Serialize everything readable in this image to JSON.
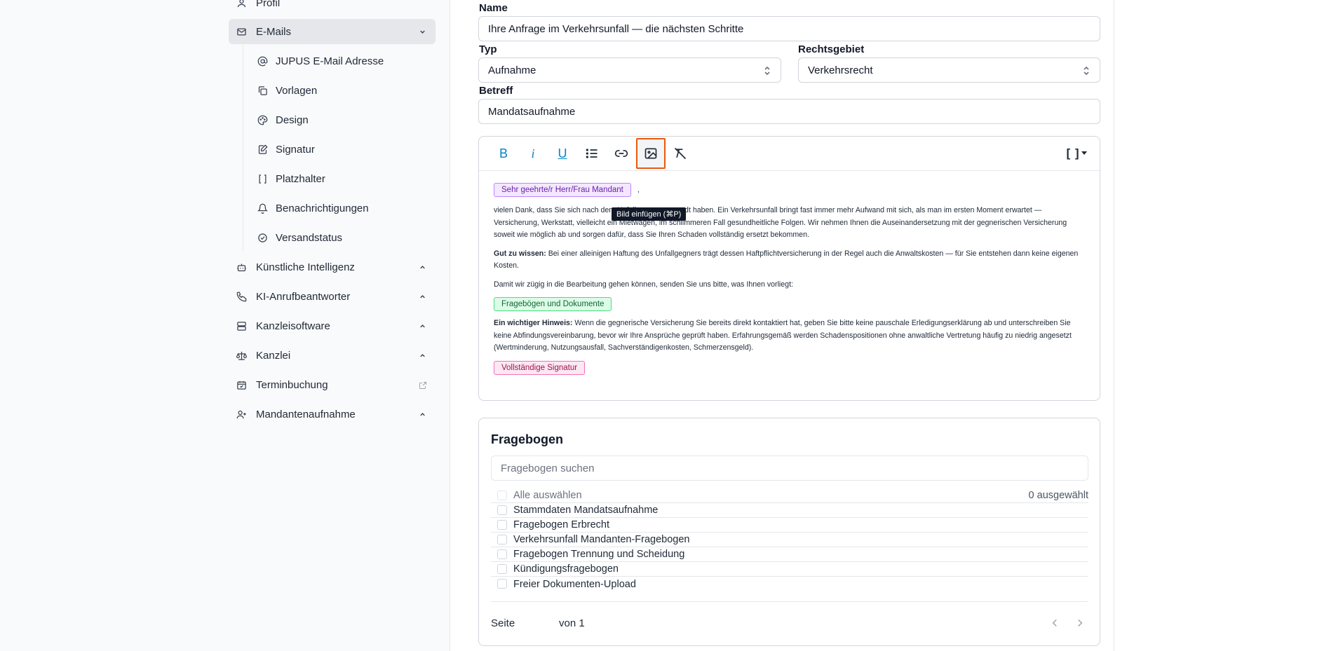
{
  "sidebar": {
    "items": [
      {
        "label": "Profil",
        "icon": "user-icon"
      },
      {
        "label": "E-Mails",
        "icon": "mail-icon",
        "expanded": true
      },
      {
        "label": "Künstliche Intelligenz",
        "icon": "bot-icon"
      },
      {
        "label": "KI-Anrufbeantworter",
        "icon": "phone-icon"
      },
      {
        "label": "Kanzleisoftware",
        "icon": "server-icon"
      },
      {
        "label": "Kanzlei",
        "icon": "scale-icon"
      },
      {
        "label": "Terminbuchung",
        "icon": "calendar-icon"
      },
      {
        "label": "Mandantenaufnahme",
        "icon": "user-plus-icon"
      }
    ],
    "email_subitems": [
      {
        "label": "JUPUS E-Mail Adresse",
        "icon": "at-icon"
      },
      {
        "label": "Vorlagen",
        "icon": "copy-icon"
      },
      {
        "label": "Design",
        "icon": "palette-icon"
      },
      {
        "label": "Signatur",
        "icon": "edit-icon"
      },
      {
        "label": "Platzhalter",
        "icon": "brackets-icon"
      },
      {
        "label": "Benachrichtigungen",
        "icon": "bell-icon"
      },
      {
        "label": "Versandstatus",
        "icon": "check-circle-icon"
      }
    ]
  },
  "form": {
    "name_label": "Name",
    "name_value": "Ihre Anfrage im Verkehrsunfall — die nächsten Schritte",
    "type_label": "Typ",
    "type_value": "Aufnahme",
    "area_label": "Rechtsgebiet",
    "area_value": "Verkehrsrecht",
    "subject_label": "Betreff",
    "subject_value": "Mandatsaufnahme"
  },
  "editor": {
    "tooltip": "Bild einfügen (⌘P)",
    "toolbar": {
      "bold": "B",
      "italic": "i",
      "underline": "U",
      "placeholder_menu": "[ ]"
    },
    "chip_greeting": "Sehr geehrte/r Herr/Frau Mandant",
    "greeting_suffix": ",",
    "p1": "vielen Dank, dass Sie sich nach dem Unfall an uns gewandt haben. Ein Verkehrsunfall bringt fast immer mehr Aufwand mit sich, als man im ersten Moment erwartet — Versicherung, Werkstatt, vielleicht ein Mietwagen, im schlimmeren Fall gesundheitliche Folgen. Wir nehmen Ihnen die Auseinandersetzung mit der gegnerischen Versicherung soweit wie möglich ab und sorgen dafür, dass Sie Ihren Schaden vollständig ersetzt bekommen.",
    "p2_bold": "Gut zu wissen:",
    "p2": " Bei einer alleinigen Haftung des Unfallgegners trägt dessen Haftpflichtversicherung in der Regel auch die Anwaltskosten — für Sie entstehen dann keine eigenen Kosten.",
    "p3": "Damit wir zügig in die Bearbeitung gehen können, senden Sie uns bitte, was Ihnen vorliegt:",
    "chip_docs": "Fragebögen und Dokumente",
    "p4_bold": "Ein wichtiger Hinweis:",
    "p4": " Wenn die gegnerische Versicherung Sie bereits direkt kontaktiert hat, geben Sie bitte keine pauschale Erledigungserklärung ab und unterschreiben Sie keine Abfindungsvereinbarung, bevor wir Ihre Ansprüche geprüft haben. Erfahrungsgemäß werden Schadenspositionen ohne anwaltliche Vertretung häufig zu niedrig angesetzt (Wertminderung, Nutzungsausfall, Sachverständigenkosten, Schmerzensgeld).",
    "chip_signature": "Vollständige Signatur"
  },
  "questionnaire": {
    "title": "Fragebogen",
    "search_placeholder": "Fragebogen suchen",
    "select_all": "Alle auswählen",
    "selected_count": "0 ausgewählt",
    "items": [
      "Stammdaten Mandatsaufnahme",
      "Fragebogen Erbrecht",
      "Verkehrsunfall Mandanten-Fragebogen",
      "Fragebogen Trennung und Scheidung",
      "Kündigungsfragebogen",
      "Freier Dokumenten-Upload"
    ],
    "page_label": "Seite",
    "page_of": "von 1"
  },
  "colors": {
    "accent": "#0284c7",
    "selected_border": "#ea580c",
    "sidebar_bg": "#f9fafb"
  }
}
